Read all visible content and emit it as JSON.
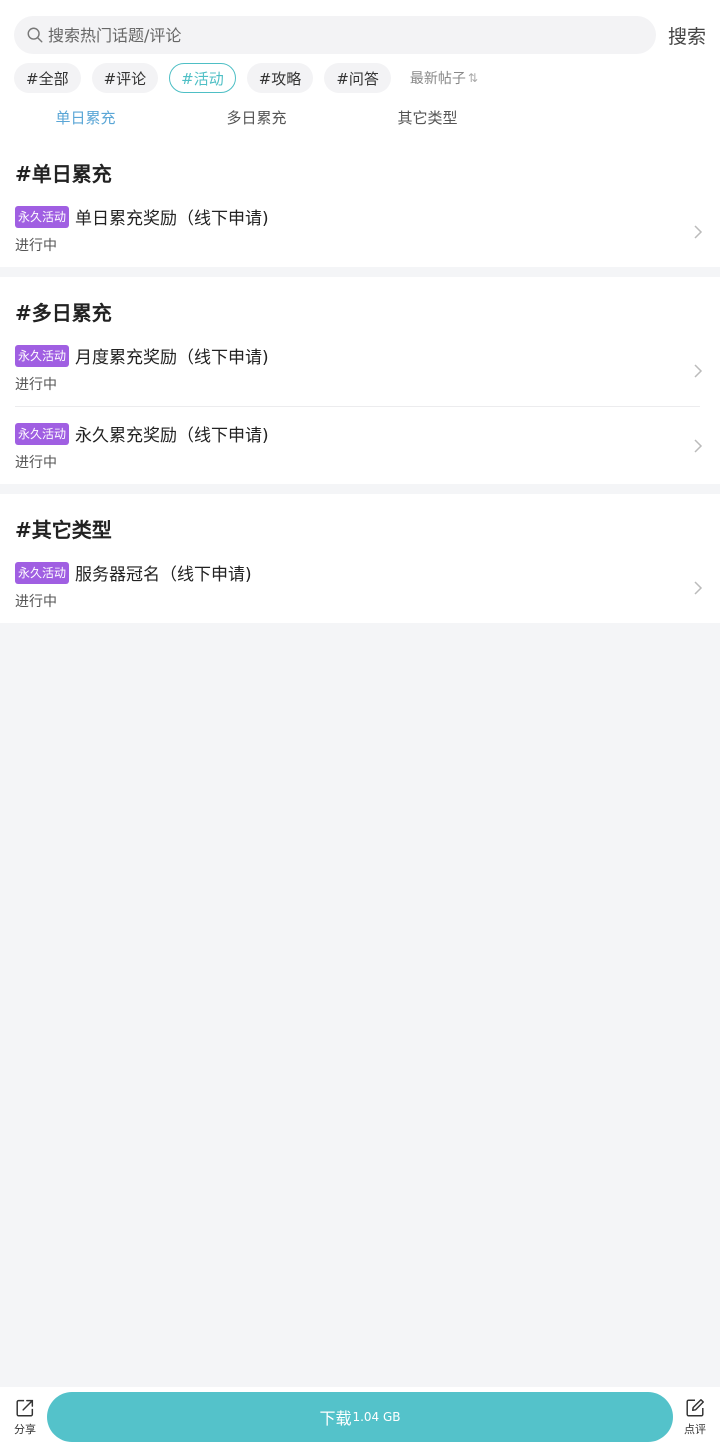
{
  "search": {
    "placeholder": "搜索热门话题/评论",
    "button": "搜索"
  },
  "tags": [
    {
      "label": "#全部",
      "active": false
    },
    {
      "label": "#评论",
      "active": false
    },
    {
      "label": "#活动",
      "active": true
    },
    {
      "label": "#攻略",
      "active": false
    },
    {
      "label": "#问答",
      "active": false
    }
  ],
  "sort_label": "最新帖子",
  "sub_tabs": [
    {
      "label": "单日累充",
      "active": true
    },
    {
      "label": "多日累充",
      "active": false
    },
    {
      "label": "其它类型",
      "active": false
    }
  ],
  "sections": [
    {
      "title": "#单日累充",
      "items": [
        {
          "badge": "永久活动",
          "title": "单日累充奖励（线下申请)",
          "status": "进行中"
        }
      ]
    },
    {
      "title": "#多日累充",
      "items": [
        {
          "badge": "永久活动",
          "title": "月度累充奖励（线下申请)",
          "status": "进行中"
        },
        {
          "badge": "永久活动",
          "title": "永久累充奖励（线下申请)",
          "status": "进行中"
        }
      ]
    },
    {
      "title": "#其它类型",
      "items": [
        {
          "badge": "永久活动",
          "title": "服务器冠名（线下申请)",
          "status": "进行中"
        }
      ]
    }
  ],
  "bottom": {
    "share_label": "分享",
    "download_label": "下载",
    "download_size": "1.04 GB",
    "review_label": "点评"
  },
  "colors": {
    "accent": "#4ebfc5",
    "download": "#54c2ca",
    "badge": "#a05fe2",
    "subtab_active": "#5aa6d6"
  },
  "icons": [
    "search-icon",
    "sort-icon",
    "chevron-right-icon",
    "share-icon",
    "edit-icon"
  ]
}
